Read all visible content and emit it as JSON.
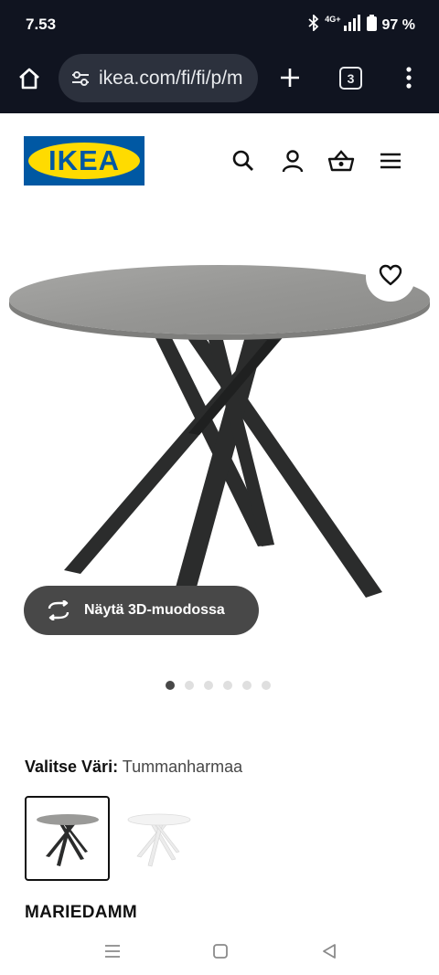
{
  "status_bar": {
    "time": "7.53",
    "network": "4G+",
    "battery": "97 %",
    "icons": [
      "bluetooth-icon",
      "signal-icon",
      "battery-icon"
    ]
  },
  "browser": {
    "url": "ikea.com/fi/fi/p/m",
    "tab_count": "3",
    "icons": [
      "home-icon",
      "tune-icon",
      "plus-icon",
      "more-vert-icon"
    ]
  },
  "header": {
    "logo_text": "IKEA",
    "icons": [
      "search-icon",
      "account-icon",
      "basket-icon",
      "hamburger-menu-icon"
    ]
  },
  "product": {
    "view_3d_label": "Näytä 3D-muodossa",
    "image_count": 6,
    "active_image": 1,
    "color_label": "Valitse Väri:",
    "color_value": "Tummanharmaa",
    "variants": [
      "dark-grey",
      "white"
    ],
    "name": "MARIEDAMM"
  },
  "colors": {
    "status_bg": "#101420",
    "url_pill": "#2c313d",
    "ikea_blue": "#0058a3",
    "ikea_yellow": "#ffdb00",
    "button_dark": "#484848",
    "table_top": "#9a9a98",
    "legs": "#2a2b2b"
  }
}
